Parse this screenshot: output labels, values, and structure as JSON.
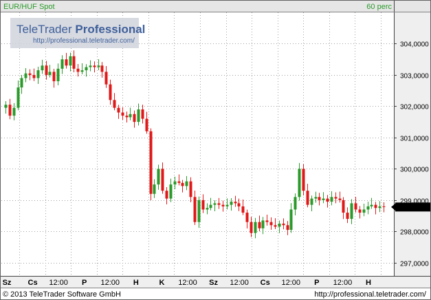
{
  "header": {
    "symbol": "EUR/HUF Spot",
    "interval": "60 perc"
  },
  "watermark": {
    "title_regular": "TeleTrader ",
    "title_bold": "Professional",
    "url": "http://professional.teletrader.com/"
  },
  "footer": {
    "copyright": "© 2013 TeleTrader Software GmbH",
    "url": "http://professional.teletrader.com/"
  },
  "colors": {
    "up": "#2a9a2a",
    "down": "#e01818",
    "header_bg": "#e6e6e6",
    "axis_bg": "#efefef",
    "grid": "#a0a0a0",
    "watermark_text": "#3f5f9a",
    "watermark_bg": "#d0d4dc",
    "last_price_bg": "#000000"
  },
  "chart_data": {
    "type": "candlestick",
    "title": "EUR/HUF Spot",
    "interval": "60 perc",
    "ylim": [
      296.6,
      305.0
    ],
    "grid": true,
    "y_tick_labels": [
      "304,0000",
      "303,0000",
      "302,0000",
      "301,0000",
      "300,0000",
      "299,0000",
      "298,0000",
      "297,0000"
    ],
    "y_tick_values": [
      304,
      303,
      302,
      301,
      300,
      299,
      298,
      297
    ],
    "x_tick_labels": [
      "Sz",
      "Cs",
      "12:00",
      "P",
      "12:00",
      "H",
      "K",
      "12:00",
      "Sz",
      "12:00",
      "Cs",
      "12:00",
      "P",
      "12:00",
      "H"
    ],
    "x_tick_bold": [
      true,
      true,
      false,
      true,
      false,
      true,
      true,
      false,
      true,
      false,
      true,
      false,
      true,
      false,
      true
    ],
    "last_price_label": "298,7800",
    "last_price": 298.78,
    "close_series": [
      302.05,
      301.7,
      301.95,
      302.6,
      302.9,
      303.05,
      303.0,
      302.9,
      303.15,
      303.3,
      303.0,
      303.1,
      302.8,
      303.2,
      303.5,
      303.3,
      303.6,
      303.2,
      303.1,
      303.15,
      303.25,
      303.3,
      303.25,
      303.3,
      303.1,
      302.7,
      302.2,
      301.95,
      301.8,
      301.7,
      301.65,
      301.75,
      301.5,
      301.9,
      301.6,
      301.2,
      299.2,
      299.5,
      300.0,
      299.3,
      299.05,
      299.5,
      299.6,
      299.55,
      299.45,
      299.6,
      299.1,
      298.3,
      299.0,
      298.7,
      298.75,
      298.85,
      298.9,
      298.85,
      298.8,
      298.85,
      298.95,
      298.9,
      298.8,
      298.6,
      298.3,
      297.95,
      298.3,
      298.1,
      298.35,
      298.3,
      298.2,
      298.15,
      298.25,
      298.2,
      298.05,
      298.7,
      299.1,
      300.0,
      299.3,
      298.85,
      299.05,
      299.1,
      299.0,
      299.05,
      298.95,
      299.1,
      299.05,
      299.0,
      298.6,
      298.4,
      298.9,
      298.7,
      298.6,
      298.7,
      298.8,
      298.85,
      298.75,
      298.8,
      298.78
    ]
  }
}
